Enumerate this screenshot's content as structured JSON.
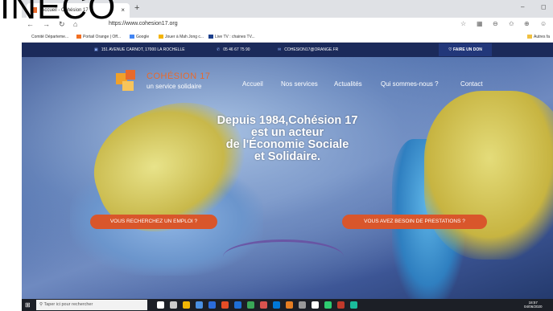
{
  "overlay": {
    "title": "INECO"
  },
  "browser": {
    "tab_title": "Accueil - Cohésion 17",
    "tab_close": "×",
    "new_tab": "+",
    "window_controls": [
      "–",
      "◻"
    ],
    "url": "https://www.cohesion17.org",
    "nav_icons": [
      "←",
      "→",
      "↻",
      "⌂"
    ],
    "right_icons": [
      "☆",
      "▦",
      "⊖",
      "✩",
      "⊕",
      "☺"
    ],
    "bookmarks": [
      {
        "label": "Comité Départeme...",
        "color": "#ffffff"
      },
      {
        "label": "Portail Orange | Off...",
        "color": "#f26f21"
      },
      {
        "label": "Google",
        "color": "#4285f4"
      },
      {
        "label": "Jouer à Mah Jong c...",
        "color": "#f4b400"
      },
      {
        "label": "Live TV : chaines TV...",
        "color": "#1c3f8c"
      },
      {
        "label": "Autres fa",
        "color": "#f0c040"
      }
    ]
  },
  "site": {
    "topbar": {
      "address": "151 AVENUE CARNOT, 17000 LA ROCHELLE",
      "phone": "05 46 67 75 90",
      "email": "COHESION17@ORANGE.FR",
      "donate": "FAIRE UN DON",
      "address_icon": "▣",
      "phone_icon": "✆",
      "email_icon": "✉",
      "donate_icon": "♡"
    },
    "logo": {
      "title": "COHÉSION 17",
      "subtitle": "un service solidaire"
    },
    "menu": [
      "Accueil",
      "Nos services",
      "Actualités",
      "Qui sommes-nous ?",
      "Contact"
    ],
    "headline": [
      "Depuis 1984,Cohésion 17",
      "est un acteur",
      "de l'Économie Sociale",
      "et Solidaire."
    ],
    "cta_left": "VOUS RECHERCHEZ UN EMPLOI ?",
    "cta_right": "VOUS AVEZ BESOIN DE PRESTATIONS ?"
  },
  "taskbar": {
    "start": "⊞",
    "search_placeholder": "Taper ici pour rechercher",
    "search_icon": "⚲",
    "icon_colors": [
      "#ffffff",
      "#cccccc",
      "#f2b705",
      "#4a90e2",
      "#2b6cdb",
      "#e44d26",
      "#1f6fd6",
      "#3aa757",
      "#d9534f",
      "#0078d7",
      "#e67e22",
      "#999999",
      "#ffffff",
      "#2ecc71",
      "#c0392b",
      "#1abc9c"
    ],
    "clock_time": "18:57",
    "clock_date": "04/06/2020"
  }
}
